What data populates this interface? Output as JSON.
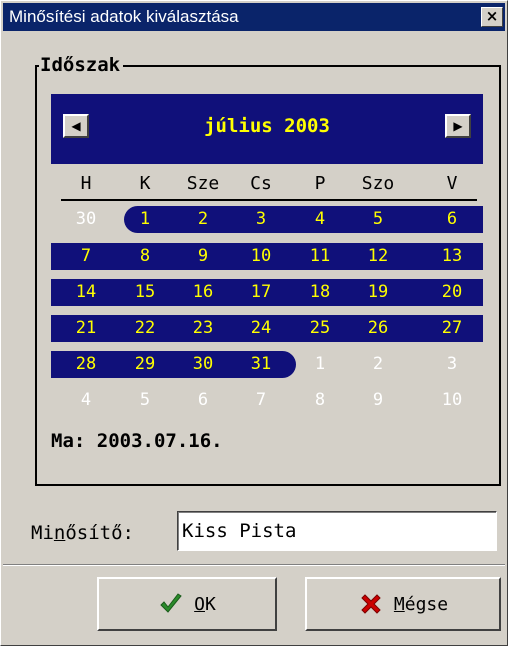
{
  "window": {
    "title": "Minősítési adatok kiválasztása",
    "close_label": "×"
  },
  "period": {
    "label": "Időszak",
    "calendar": {
      "prev_label": "◀",
      "next_label": "▶",
      "month_title": "július 2003",
      "weekdays": [
        "H",
        "K",
        "Sze",
        "Cs",
        "P",
        "Szo",
        "V"
      ],
      "weeks": [
        [
          {
            "d": "30",
            "in": false
          },
          {
            "d": "1",
            "in": true
          },
          {
            "d": "2",
            "in": true
          },
          {
            "d": "3",
            "in": true
          },
          {
            "d": "4",
            "in": true
          },
          {
            "d": "5",
            "in": true
          },
          {
            "d": "6",
            "in": true
          }
        ],
        [
          {
            "d": "7",
            "in": true
          },
          {
            "d": "8",
            "in": true
          },
          {
            "d": "9",
            "in": true
          },
          {
            "d": "10",
            "in": true
          },
          {
            "d": "11",
            "in": true
          },
          {
            "d": "12",
            "in": true
          },
          {
            "d": "13",
            "in": true
          }
        ],
        [
          {
            "d": "14",
            "in": true
          },
          {
            "d": "15",
            "in": true
          },
          {
            "d": "16",
            "in": true
          },
          {
            "d": "17",
            "in": true
          },
          {
            "d": "18",
            "in": true
          },
          {
            "d": "19",
            "in": true
          },
          {
            "d": "20",
            "in": true
          }
        ],
        [
          {
            "d": "21",
            "in": true
          },
          {
            "d": "22",
            "in": true
          },
          {
            "d": "23",
            "in": true
          },
          {
            "d": "24",
            "in": true
          },
          {
            "d": "25",
            "in": true
          },
          {
            "d": "26",
            "in": true
          },
          {
            "d": "27",
            "in": true
          }
        ],
        [
          {
            "d": "28",
            "in": true
          },
          {
            "d": "29",
            "in": true
          },
          {
            "d": "30",
            "in": true
          },
          {
            "d": "31",
            "in": true
          },
          {
            "d": "1",
            "in": false
          },
          {
            "d": "2",
            "in": false
          },
          {
            "d": "3",
            "in": false
          }
        ],
        [
          {
            "d": "4",
            "in": false
          },
          {
            "d": "5",
            "in": false
          },
          {
            "d": "6",
            "in": false
          },
          {
            "d": "7",
            "in": false
          },
          {
            "d": "8",
            "in": false
          },
          {
            "d": "9",
            "in": false
          },
          {
            "d": "10",
            "in": false
          }
        ]
      ]
    },
    "today_text": "Ma: 2003.07.16."
  },
  "rater": {
    "label_pre": "Mi",
    "label_accel": "n",
    "label_post": "ősítő:",
    "value": "Kiss Pista"
  },
  "buttons": {
    "ok": {
      "accel": "O",
      "rest": "K",
      "icon": "checkmark-icon"
    },
    "cancel": {
      "accel": "M",
      "rest": "égse",
      "icon": "x-icon"
    }
  },
  "colors": {
    "titlebar": "#0a246a",
    "calendar_bg": "#10107a",
    "day_text": "#ffff00",
    "other_day_text": "#ffffff",
    "ok_icon": "#2a8a2a",
    "cancel_icon": "#cc0000"
  }
}
